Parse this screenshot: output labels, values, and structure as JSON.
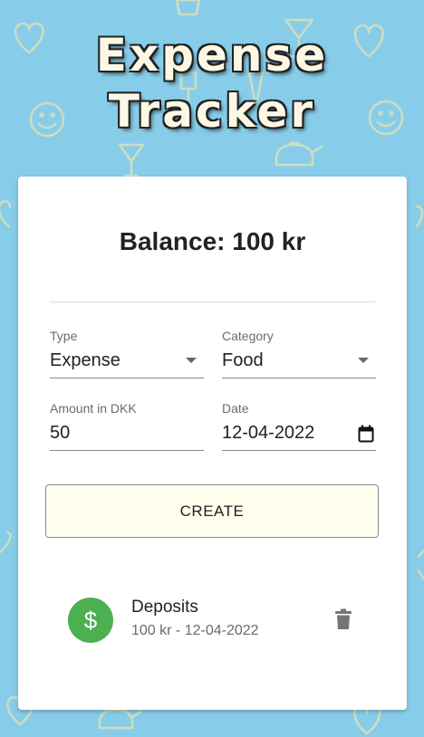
{
  "app": {
    "title_line1": "Expense",
    "title_line2": "Tracker"
  },
  "balance": {
    "text": "Balance: 100 kr"
  },
  "form": {
    "type": {
      "label": "Type",
      "value": "Expense"
    },
    "category": {
      "label": "Category",
      "value": "Food"
    },
    "amount": {
      "label": "Amount in DKK",
      "value": "50"
    },
    "date": {
      "label": "Date",
      "value": "12-04-2022"
    },
    "create_label": "CREATE"
  },
  "transactions": [
    {
      "name": "Deposits",
      "details": "100 kr - 12-04-2022",
      "icon": "dollar-icon",
      "icon_glyph": "$"
    }
  ],
  "colors": {
    "background": "#87cdea",
    "avatar": "#4caf50",
    "button": "#fffeed",
    "title_fill": "#fdf8e6"
  }
}
